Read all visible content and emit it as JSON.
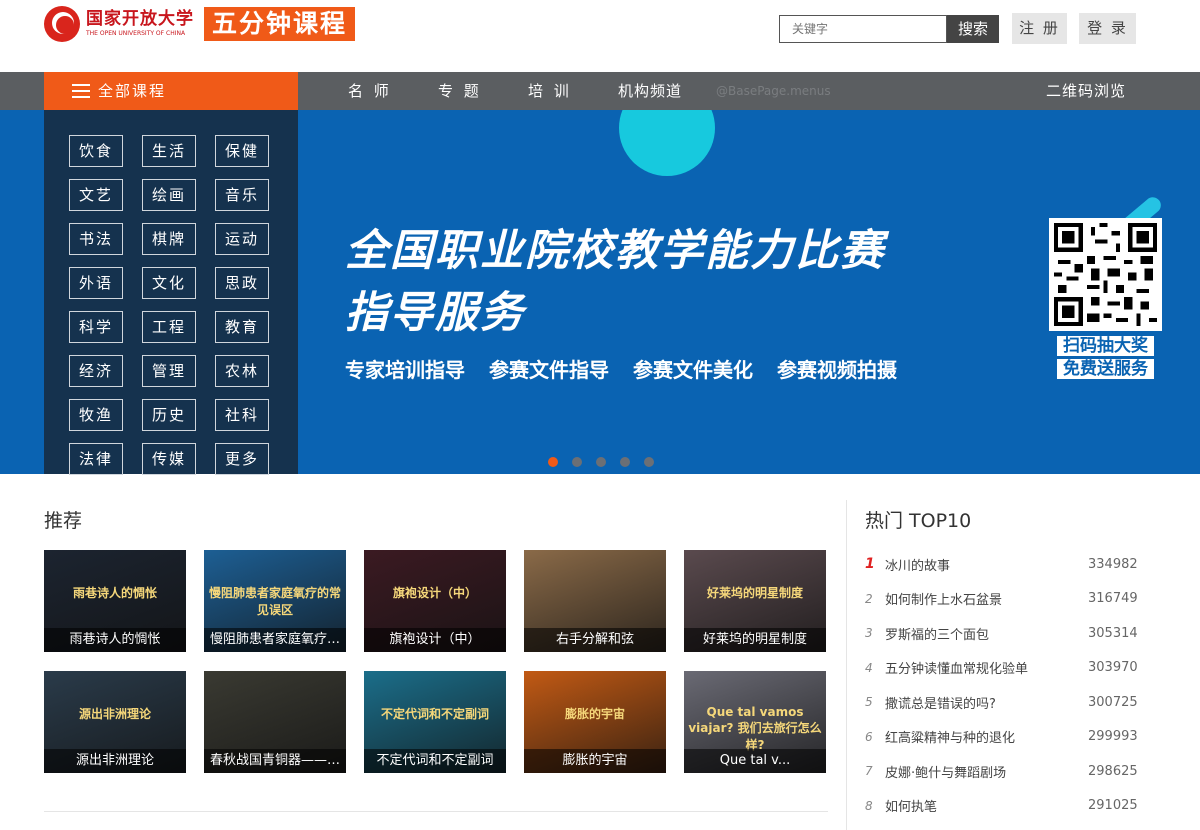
{
  "header": {
    "logo_cn": "国家开放大学",
    "logo_en": "THE OPEN UNIVERSITY OF CHINA",
    "brand": "五分钟课程",
    "search_placeholder": "关键字",
    "search_button": "搜索",
    "register": "注 册",
    "login": "登 录"
  },
  "nav": {
    "all_courses": "全部课程",
    "items": [
      "名 师",
      "专 题",
      "培 训",
      "机构频道"
    ],
    "ghost": "@BasePage.menus",
    "qr_browse": "二维码浏览"
  },
  "categories": [
    "饮食",
    "生活",
    "保健",
    "文艺",
    "绘画",
    "音乐",
    "书法",
    "棋牌",
    "运动",
    "外语",
    "文化",
    "思政",
    "科学",
    "工程",
    "教育",
    "经济",
    "管理",
    "农林",
    "牧渔",
    "历史",
    "社科",
    "法律",
    "传媒",
    "更多"
  ],
  "banner": {
    "title_line1": "全国职业院校教学能力比赛",
    "title_line2": "指导服务",
    "subs": [
      "专家培训指导",
      "参赛文件指导",
      "参赛文件美化",
      "参赛视频拍摄"
    ],
    "qr_line1": "扫码抽大奖",
    "qr_line2": "免费送服务",
    "dots": 5,
    "active_dot": 0
  },
  "recommend": {
    "title": "推荐",
    "cards": [
      {
        "caption": "雨巷诗人的惆怅",
        "thumb_text": "雨巷诗人的惆怅",
        "bg": "#1c2430"
      },
      {
        "caption": "慢阻肺患者家庭氧疗…",
        "thumb_text": "慢阻肺患者家庭氧疗的常见误区",
        "bg": "#1d5f94"
      },
      {
        "caption": "旗袍设计（中）",
        "thumb_text": "旗袍设计（中）",
        "bg": "#3b1a22"
      },
      {
        "caption": "右手分解和弦",
        "thumb_text": "",
        "bg": "#8a6a48"
      },
      {
        "caption": "好莱坞的明星制度",
        "thumb_text": "好莱坞的明星制度",
        "bg": "#5a4a4e"
      },
      {
        "caption": "源出非洲理论",
        "thumb_text": "源出非洲理论",
        "bg": "#2a3b4a"
      },
      {
        "caption": "春秋战国青铜器——…",
        "thumb_text": "",
        "bg": "#3a3a32"
      },
      {
        "caption": "不定代词和不定副词",
        "thumb_text": "不定代词和不定副词",
        "bg": "#1b6e8a"
      },
      {
        "caption": "膨胀的宇宙",
        "thumb_text": "膨胀的宇宙",
        "bg": "#c25a14"
      },
      {
        "caption": "Que tal v...",
        "thumb_text": "Que tal vamos viajar? 我们去旅行怎么样?",
        "bg": "#6a6a74"
      }
    ]
  },
  "hot": {
    "title": "热门 TOP10",
    "items": [
      {
        "rank": "1",
        "name": "冰川的故事",
        "count": "334982"
      },
      {
        "rank": "2",
        "name": "如何制作上水石盆景",
        "count": "316749"
      },
      {
        "rank": "3",
        "name": "罗斯福的三个面包",
        "count": "305314"
      },
      {
        "rank": "4",
        "name": "五分钟读懂血常规化验单",
        "count": "303970"
      },
      {
        "rank": "5",
        "name": "撒谎总是错误的吗?",
        "count": "300725"
      },
      {
        "rank": "6",
        "name": "红高粱精神与种的退化",
        "count": "299993"
      },
      {
        "rank": "7",
        "name": "皮娜·鲍什与舞蹈剧场",
        "count": "298625"
      },
      {
        "rank": "8",
        "name": "如何执笔",
        "count": "291025"
      }
    ]
  },
  "colors": {
    "accent": "#f05a18",
    "nav_bg": "#5b5e61",
    "banner_bg": "#0a63b2",
    "rank1": "#e02020"
  }
}
